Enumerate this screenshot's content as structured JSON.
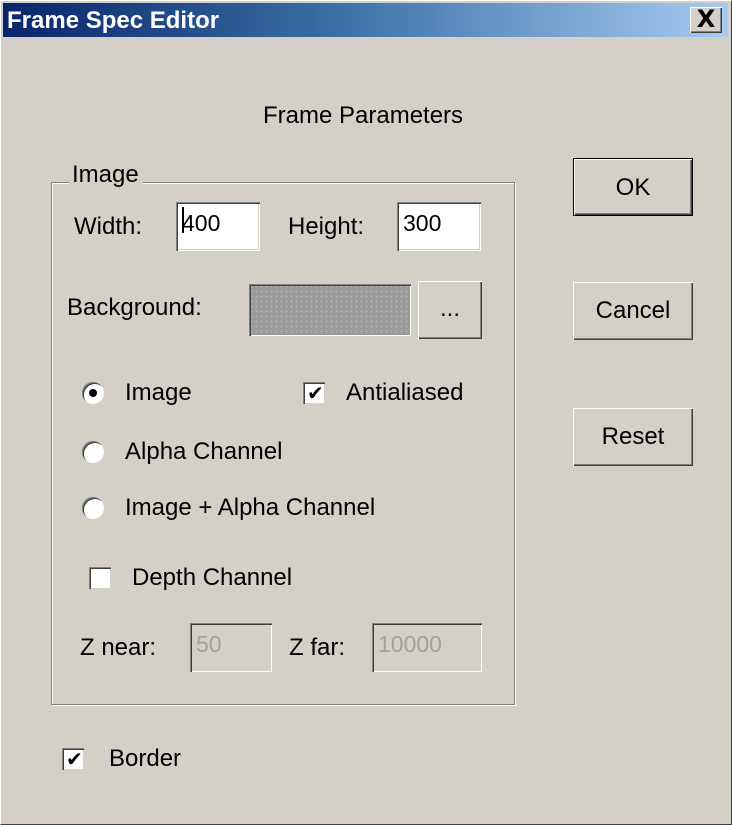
{
  "window": {
    "title": "Frame Spec Editor",
    "close_glyph": "X"
  },
  "heading": "Frame Parameters",
  "image_group": {
    "legend": "Image",
    "width_label": "Width:",
    "width_value": "400",
    "height_label": "Height:",
    "height_value": "300",
    "background_label": "Background:",
    "browse_label": "...",
    "background_color": "#9a9a9a"
  },
  "output_mode": {
    "options": [
      "Image",
      "Alpha Channel",
      "Image + Alpha Channel"
    ],
    "selected": "Image"
  },
  "antialiased": {
    "label": "Antialiased",
    "checked": true
  },
  "depth_channel": {
    "label": "Depth Channel",
    "checked": false
  },
  "z_near": {
    "label": "Z near:",
    "value": "50",
    "disabled": true
  },
  "z_far": {
    "label": "Z far:",
    "value": "10000",
    "disabled": true
  },
  "border": {
    "label": "Border",
    "checked": true
  },
  "buttons": {
    "ok": "OK",
    "cancel": "Cancel",
    "reset": "Reset"
  },
  "colors": {
    "title_gradient_start": "#0a246a",
    "title_gradient_end": "#a6caf0",
    "dialog_face": "#d4d0c8"
  }
}
